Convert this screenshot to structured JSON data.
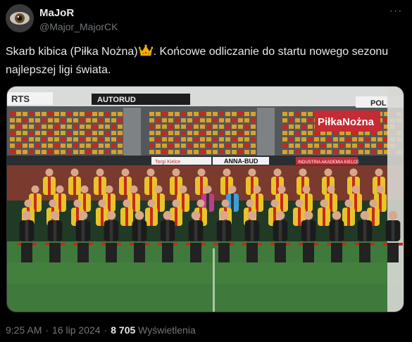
{
  "author": {
    "display_name": "MaJoR",
    "handle": "@Major_MajorCK"
  },
  "menu_glyph": "···",
  "tweet": {
    "text_part1": "Skarb kibica (Piłka Nożna)",
    "emoji": "crown-emoji",
    "text_part2": ". Końcowe odliczanie do startu nowego sezonu najlepszej ligi świata."
  },
  "photo": {
    "banners": {
      "pilka_nozna": "PiłkaNożna",
      "anna_bud": "ANNA-BUD",
      "autorud": "AUTORUD",
      "arts": "RTS",
      "pol": "POL",
      "torgi": "Torgi Kielce",
      "industria": "INDUSTRIA AKADEMIA KIELCE"
    },
    "colors": {
      "kit_yellow": "#e8c42a",
      "kit_red": "#c7281e",
      "staff_black": "#1b1b1b",
      "pitch_green": "#3f7a3c",
      "seat_orange": "#d8a12a",
      "banner_red": "#c62a33"
    }
  },
  "meta": {
    "time": "9:25 AM",
    "separator": "·",
    "date": "16 lip 2024",
    "views_count": "8 705",
    "views_label": "Wyświetlenia"
  }
}
